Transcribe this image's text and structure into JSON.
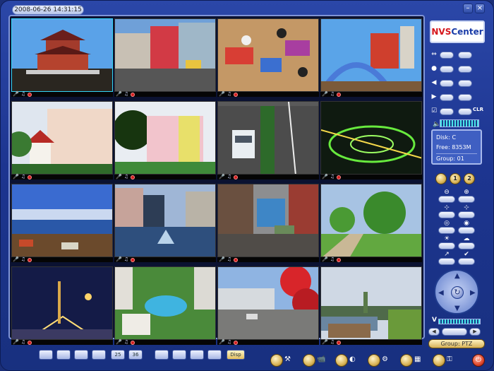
{
  "header": {
    "datetime": "2008-06-26 14:31:15"
  },
  "window_controls": [
    {
      "name": "minimize-button",
      "icon": "minimize-icon"
    },
    {
      "name": "close-button",
      "icon": "close-icon"
    }
  ],
  "logo": {
    "part1": "NVS",
    "part2": "Center"
  },
  "camera_status_icons": [
    "microphone-icon",
    "music-note-icon",
    "record-indicator-icon"
  ],
  "cameras": [
    {
      "id": 1,
      "scene": "pagoda",
      "selected": true
    },
    {
      "id": 2,
      "scene": "street-shops"
    },
    {
      "id": 3,
      "scene": "classroom"
    },
    {
      "id": 4,
      "scene": "playground"
    },
    {
      "id": 5,
      "scene": "school-building"
    },
    {
      "id": 6,
      "scene": "colorful-building"
    },
    {
      "id": 7,
      "scene": "road-car"
    },
    {
      "id": 8,
      "scene": "night-interchange"
    },
    {
      "id": 9,
      "scene": "city-bay"
    },
    {
      "id": 10,
      "scene": "plaza-pyramid"
    },
    {
      "id": 11,
      "scene": "city-street"
    },
    {
      "id": 12,
      "scene": "park-path"
    },
    {
      "id": 13,
      "scene": "night-plaza"
    },
    {
      "id": 14,
      "scene": "resort-pool"
    },
    {
      "id": 15,
      "scene": "blossom-road"
    },
    {
      "id": 16,
      "scene": "wetland-park"
    }
  ],
  "side_panel": {
    "clr_label": "CLR",
    "disk_label": "Disk:",
    "disk_value": "C",
    "free_label": "Free:",
    "free_value": "8353M",
    "group_label": "Group:",
    "group_value": "01",
    "page_buttons": [
      "1",
      "2"
    ],
    "speed_label": "V",
    "group_ptz_label": "Group: PTZ"
  },
  "bottom_toolbar": {
    "layouts": [
      "",
      "",
      "",
      "",
      "25",
      "36",
      "",
      "",
      "",
      "",
      "Disp"
    ]
  },
  "colors": {
    "frame_bg": "#1d3590",
    "selected_border": "#33d6f5",
    "record": "#d21f1f"
  }
}
